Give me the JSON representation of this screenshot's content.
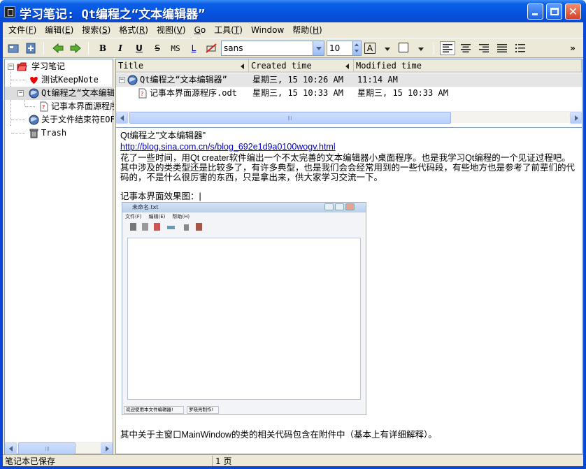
{
  "window": {
    "title": "学习笔记: Qt编程之“文本编辑器”"
  },
  "menubar": {
    "items": [
      {
        "label": "文件(",
        "key": "F",
        "end": ")"
      },
      {
        "label": "编辑(",
        "key": "E",
        "end": ")"
      },
      {
        "label": "搜索(",
        "key": "S",
        "end": ")"
      },
      {
        "label": "格式(",
        "key": "R",
        "end": ")"
      },
      {
        "label": "视图(",
        "key": "V",
        "end": ")"
      },
      {
        "label": "",
        "key": "G",
        "end": "o"
      },
      {
        "label": "工具(",
        "key": "T",
        "end": ")"
      },
      {
        "label": "Window",
        "key": "",
        "end": ""
      },
      {
        "label": "帮助(",
        "key": "H",
        "end": ")"
      }
    ]
  },
  "toolbar": {
    "bold": "B",
    "italic": "I",
    "underline": "U",
    "strike": "S",
    "monospace": "MS",
    "link": "L",
    "font_name": "sans",
    "font_size": "10",
    "text_color_letter": "A",
    "overflow": "»"
  },
  "tree": {
    "items": [
      {
        "label": "学习笔记",
        "icon": "folder-open-icon"
      },
      {
        "label": "测试KeepNote",
        "icon": "heart-icon"
      },
      {
        "label": "Qt编程之“文本编辑器”",
        "icon": "globe-note-icon"
      },
      {
        "label": "记事本界面源程序.odt",
        "icon": "attachment-file-icon"
      },
      {
        "label": "关于文件结束符EOF",
        "icon": "globe-note-icon"
      },
      {
        "label": "Trash",
        "icon": "trash-icon"
      }
    ]
  },
  "list": {
    "columns": [
      "Title",
      "Created time",
      "Modified time"
    ],
    "rows": [
      {
        "title": "Qt编程之“文本编辑器”",
        "created": "星期三, 15 10:26 AM",
        "modified": "11:14 AM"
      },
      {
        "title": "记事本界面源程序.odt",
        "created": "星期三, 15 10:33 AM",
        "modified": "星期三, 15 10:33 AM"
      }
    ]
  },
  "editor": {
    "heading": "Qt编程之\"文本编辑器\"",
    "link": "http://blog.sina.com.cn/s/blog_692e1d9a0100wogv.html",
    "paragraph": "花了一些时间，用Qt creater软件编出一个不太完善的文本编辑器小桌面程序。也是我学习Qt编程的一个见证过程吧。其中涉及的类类型还是比较多了，有许多典型，也是我们会会经常用到的一些代码段，有些地方也是参考了前辈们的代码的，不是什么很厉害的东西，只是拿出来，供大家学习交流一下。",
    "caption": "记事本界面效果图：|",
    "footer": "其中关于主窗口MainWindow的类的相关代码包含在附件中（基本上有详细解释）。"
  },
  "embedded_screenshot": {
    "title": "未命名.txt",
    "menu": [
      "文件(F)",
      "编辑(E)",
      "帮助(H)"
    ],
    "status_left": "欢迎使用本文件编辑器!",
    "status_right": "罗晓亮制作!"
  },
  "statusbar": {
    "message": "笔记本已保存",
    "page": "1 页"
  },
  "colors": {
    "titlebar": "#0553e0",
    "link": "#0000cc",
    "selection": "#dddddd"
  }
}
